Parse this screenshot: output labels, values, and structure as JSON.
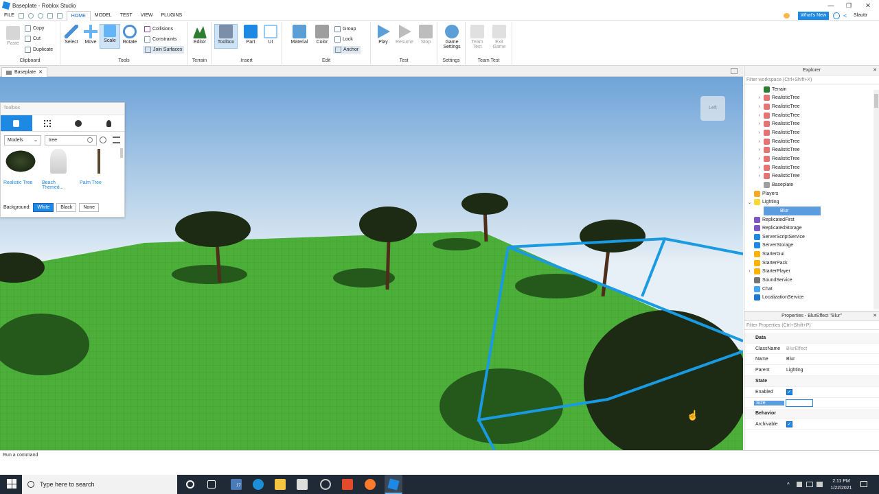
{
  "window": {
    "title": "Baseplate - Roblox Studio",
    "min": "—",
    "max": "❐",
    "close": "✕"
  },
  "menubar": {
    "items": [
      "FILE",
      "HOME",
      "MODEL",
      "TEST",
      "VIEW",
      "PLUGINS"
    ],
    "active": "HOME",
    "whats_new": "What's New",
    "user": "Slauttr"
  },
  "ribbon": {
    "clipboard": {
      "label": "Clipboard",
      "paste": "Paste",
      "copy": "Copy",
      "cut": "Cut",
      "duplicate": "Duplicate"
    },
    "tools": {
      "label": "Tools",
      "select": "Select",
      "move": "Move",
      "scale": "Scale",
      "rotate": "Rotate",
      "collisions": "Collisions",
      "constraints": "Constraints",
      "join_surfaces": "Join Surfaces"
    },
    "terrain": {
      "label": "Terrain",
      "editor": "Editor"
    },
    "insert": {
      "label": "Insert",
      "toolbox": "Toolbox",
      "part": "Part",
      "ui": "UI"
    },
    "edit": {
      "label": "Edit",
      "material": "Material",
      "color": "Color",
      "group": "Group",
      "lock": "Lock",
      "anchor": "Anchor"
    },
    "test": {
      "label": "Test",
      "play": "Play",
      "resume": "Resume",
      "stop": "Stop"
    },
    "settings": {
      "label": "Settings",
      "game_settings_1": "Game",
      "game_settings_2": "Settings"
    },
    "teamtest": {
      "label": "Team Test",
      "team_test_1": "Team",
      "team_test_2": "Test",
      "exit_game_1": "Exit",
      "exit_game_2": "Game"
    }
  },
  "doc_tab": {
    "label": "Baseplate",
    "close": "✕"
  },
  "toolbox": {
    "title": "Toolbox",
    "category": "Models",
    "search_value": "tree",
    "items": [
      {
        "label": "Realistic Tree"
      },
      {
        "label": "Beach Themed..."
      },
      {
        "label": "Palm Tree"
      }
    ],
    "background_label": "Background:",
    "bg_options": [
      "White",
      "Black",
      "None"
    ]
  },
  "viewcube": {
    "label": "Left"
  },
  "explorer": {
    "title": "Explorer",
    "filter_placeholder": "Filter workspace (Ctrl+Shift+X)",
    "rows": [
      {
        "label": "Terrain",
        "indent": 2,
        "expand": "",
        "color": "#2e7d32"
      },
      {
        "label": "RealisticTree",
        "indent": 2,
        "expand": "›",
        "color": "#e57373"
      },
      {
        "label": "RealisticTree",
        "indent": 2,
        "expand": "›",
        "color": "#e57373"
      },
      {
        "label": "RealisticTree",
        "indent": 2,
        "expand": "›",
        "color": "#e57373"
      },
      {
        "label": "RealisticTree",
        "indent": 2,
        "expand": "›",
        "color": "#e57373"
      },
      {
        "label": "RealisticTree",
        "indent": 2,
        "expand": "›",
        "color": "#e57373"
      },
      {
        "label": "RealisticTree",
        "indent": 2,
        "expand": "›",
        "color": "#e57373"
      },
      {
        "label": "RealisticTree",
        "indent": 2,
        "expand": "›",
        "color": "#e57373"
      },
      {
        "label": "RealisticTree",
        "indent": 2,
        "expand": "›",
        "color": "#e57373"
      },
      {
        "label": "RealisticTree",
        "indent": 2,
        "expand": "›",
        "color": "#e57373"
      },
      {
        "label": "RealisticTree",
        "indent": 2,
        "expand": "›",
        "color": "#e57373"
      },
      {
        "label": "Baseplate",
        "indent": 2,
        "expand": "",
        "color": "#9e9e9e"
      },
      {
        "label": "Players",
        "indent": 1,
        "expand": "",
        "color": "#f9a825"
      },
      {
        "label": "Lighting",
        "indent": 1,
        "expand": "⌄",
        "color": "#fdd835"
      },
      {
        "label": "Blur",
        "indent": 2,
        "expand": "",
        "color": "#90caf9",
        "selected": true
      },
      {
        "label": "ReplicatedFirst",
        "indent": 1,
        "expand": "",
        "color": "#7e57c2"
      },
      {
        "label": "ReplicatedStorage",
        "indent": 1,
        "expand": "",
        "color": "#7e57c2"
      },
      {
        "label": "ServerScriptService",
        "indent": 1,
        "expand": "",
        "color": "#1e88e5"
      },
      {
        "label": "ServerStorage",
        "indent": 1,
        "expand": "",
        "color": "#1e88e5"
      },
      {
        "label": "StarterGui",
        "indent": 1,
        "expand": "",
        "color": "#ffb300"
      },
      {
        "label": "StarterPack",
        "indent": 1,
        "expand": "",
        "color": "#ffb300"
      },
      {
        "label": "StarterPlayer",
        "indent": 1,
        "expand": "›",
        "color": "#ffb300"
      },
      {
        "label": "SoundService",
        "indent": 1,
        "expand": "",
        "color": "#757575"
      },
      {
        "label": "Chat",
        "indent": 1,
        "expand": "",
        "color": "#42a5f5"
      },
      {
        "label": "LocalizationService",
        "indent": 1,
        "expand": "",
        "color": "#1976d2"
      }
    ]
  },
  "properties": {
    "title": "Properties - BlurEffect \"Blur\"",
    "filter_placeholder": "Filter Properties (Ctrl+Shift+P)",
    "rows": [
      {
        "cat": true,
        "name": "Data"
      },
      {
        "name": "ClassName",
        "value": "BlurEffect",
        "dim": true
      },
      {
        "name": "Name",
        "value": "Blur"
      },
      {
        "name": "Parent",
        "value": "Lighting"
      },
      {
        "cat": true,
        "name": "State"
      },
      {
        "name": "Enabled",
        "check": true
      },
      {
        "name": "Size",
        "value": "",
        "selected": true
      },
      {
        "cat": true,
        "name": "Behavior"
      },
      {
        "name": "Archivable",
        "check": true
      }
    ]
  },
  "command_bar": {
    "placeholder": "Run a command"
  },
  "taskbar": {
    "search": "Type here to search",
    "time": "2:11 PM",
    "date": "1/22/2021",
    "mail_badge": "17"
  },
  "colors": {
    "accent": "#1e88e5",
    "ground": "#4caf3a",
    "selection": "#1a9ae0",
    "taskbar": "#202a36"
  }
}
